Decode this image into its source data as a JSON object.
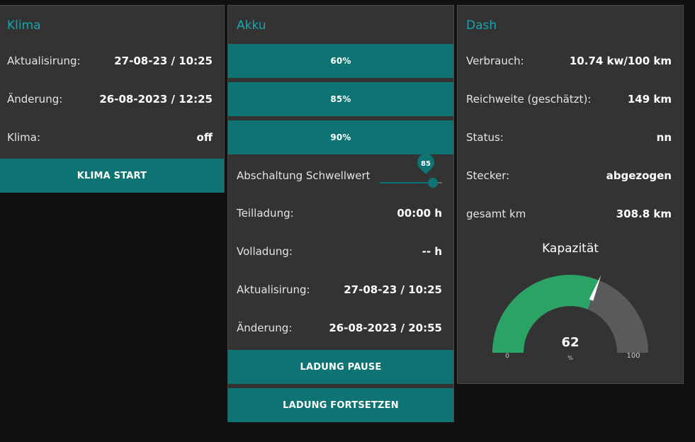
{
  "klima": {
    "title": "Klima",
    "rows": [
      {
        "label": "Aktualisirung:",
        "value": "27-08-23 / 10:25"
      },
      {
        "label": "Änderung:",
        "value": "26-08-2023 / 12:25"
      },
      {
        "label": "Klima:",
        "value": "off"
      }
    ],
    "start_button": "KLIMA START"
  },
  "akku": {
    "title": "Akku",
    "preset_buttons": [
      "60%",
      "85%",
      "90%"
    ],
    "threshold_label": "Abschaltung Schwellwert",
    "threshold_value": 85,
    "threshold_display": "85",
    "rows": [
      {
        "label": "Teilladung:",
        "value": "00:00 h"
      },
      {
        "label": "Volladung:",
        "value": "-- h"
      },
      {
        "label": "Aktualisirung:",
        "value": "27-08-23 / 10:25"
      },
      {
        "label": "Änderung:",
        "value": "26-08-2023 / 20:55"
      }
    ],
    "pause_button": "LADUNG PAUSE",
    "continue_button": "LADUNG FORTSETZEN"
  },
  "dash": {
    "title": "Dash",
    "rows": [
      {
        "label": "Verbrauch:",
        "value": "10.74 kw/100 km"
      },
      {
        "label": "Reichweite (geschätzt):",
        "value": "149 km"
      },
      {
        "label": "Status:",
        "value": "nn"
      },
      {
        "label": "Stecker:",
        "value": "abgezogen"
      },
      {
        "label": "gesamt km",
        "value": "308.8 km"
      }
    ],
    "gauge": {
      "title": "Kapazität",
      "value": 62,
      "value_text": "62",
      "min": 0,
      "max": 100,
      "min_text": "0",
      "max_text": "100",
      "unit": "%"
    }
  },
  "colors": {
    "accent": "#16a5ad",
    "button": "#0e7373",
    "gauge_fill": "#2aa365",
    "gauge_track": "#5a5a5a",
    "card_bg": "#333333",
    "page_bg": "#111111"
  }
}
